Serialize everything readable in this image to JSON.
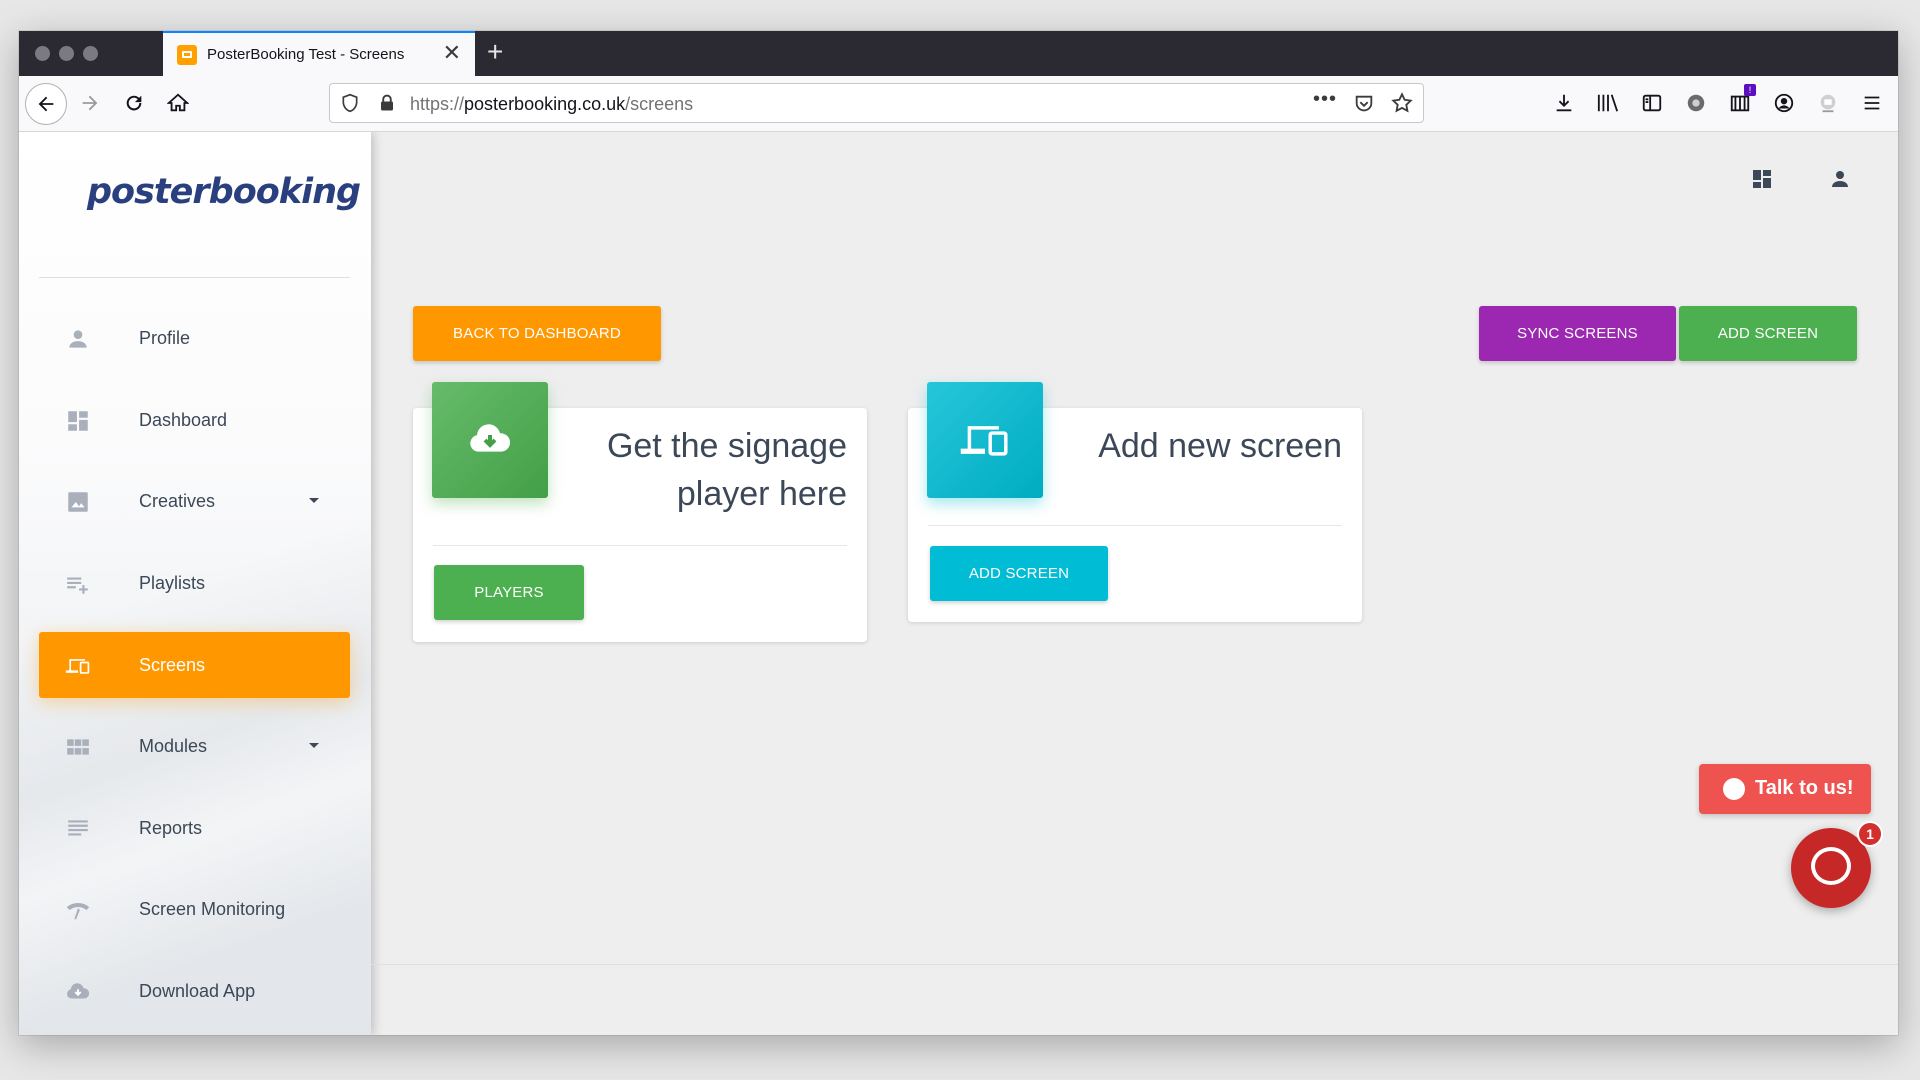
{
  "browser": {
    "tab_title": "PosterBooking Test - Screens",
    "tab_close": "✕",
    "new_tab": "+",
    "url_prefix": "https://",
    "url_domain": "posterbooking.co.uk",
    "url_path": "/screens",
    "url_more": "•••",
    "extension_badge": "!"
  },
  "sidebar": {
    "logo": "posterbooking",
    "items": [
      {
        "label": "Profile",
        "icon": "person-icon"
      },
      {
        "label": "Dashboard",
        "icon": "dashboard-icon"
      },
      {
        "label": "Creatives",
        "icon": "image-icon"
      },
      {
        "label": "Playlists",
        "icon": "playlist-add-icon"
      },
      {
        "label": "Screens",
        "icon": "devices-icon"
      },
      {
        "label": "Modules",
        "icon": "grid-icon"
      },
      {
        "label": "Reports",
        "icon": "list-icon"
      },
      {
        "label": "Screen Monitoring",
        "icon": "wifi-signal-icon"
      },
      {
        "label": "Download App",
        "icon": "cloud-download-icon"
      }
    ]
  },
  "toolbar": {
    "back_label": "BACK TO DASHBOARD",
    "sync_label": "SYNC SCREENS",
    "add_label": "ADD SCREEN"
  },
  "cards": {
    "player": {
      "title_line1": "Get the signage",
      "title_line2": "player here",
      "button": "PLAYERS"
    },
    "add_screen": {
      "title": "Add new screen",
      "button": "ADD SCREEN"
    }
  },
  "chat": {
    "talk_label": "Talk to us!",
    "badge_count": "1"
  },
  "colors": {
    "accent_orange": "#ff9800",
    "purple": "#9c27b0",
    "green": "#4caf50",
    "cyan": "#00bcd4",
    "chat_red": "#c62828"
  }
}
